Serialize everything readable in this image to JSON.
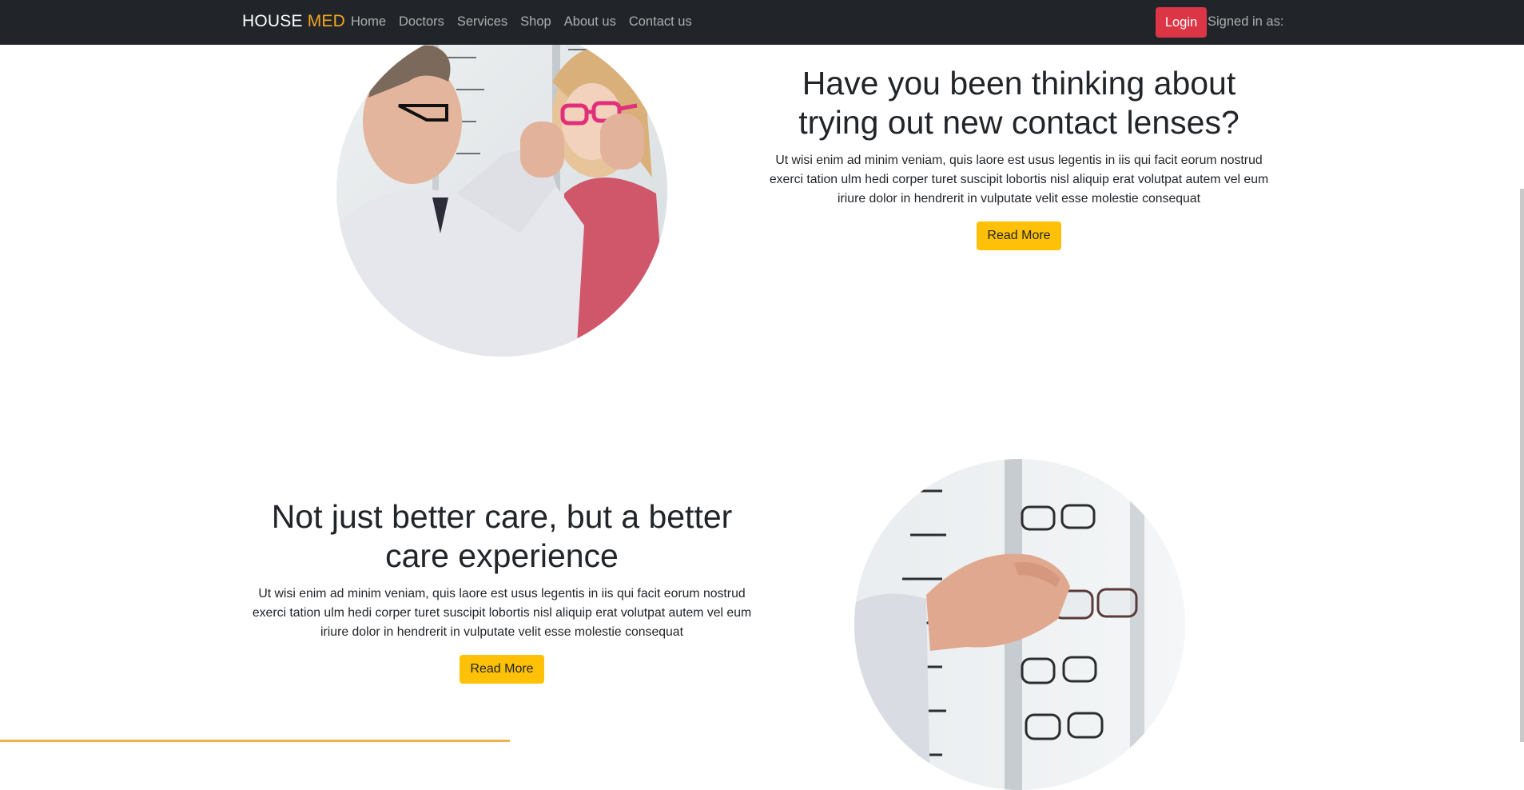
{
  "navbar": {
    "brand_part1": "HOUSE",
    "brand_part2": "MED",
    "links": [
      "Home",
      "Doctors",
      "Services",
      "Shop",
      "About us",
      "Contact us"
    ],
    "login_label": "Login",
    "signed_in_label": "Signed in as:"
  },
  "features": [
    {
      "title_line1": "Have you been thinking about",
      "title_line2": "trying out new contact lenses?",
      "body": "Ut wisi enim ad minim veniam, quis laore est usus legentis in iis qui facit eorum nostrud exerci tation ulm hedi corper turet suscipit lobortis nisl aliquip erat volutpat autem vel eum iriure dolor in hendrerit in vulputate velit esse molestie consequat",
      "button_label": "Read More"
    },
    {
      "title_line1": "Not just better care, but a better",
      "title_line2": "care experience",
      "body": "Ut wisi enim ad minim veniam, quis laore est usus legentis in iis qui facit eorum nostrud exerci tation ulm hedi corper turet suscipit lobortis nisl aliquip erat volutpat autem vel eum iriure dolor in hendrerit in vulputate velit esse molestie consequat",
      "button_label": "Read More"
    }
  ],
  "colors": {
    "navbar_bg": "#212529",
    "brand_accent": "#f5a623",
    "login_bg": "#dc3545",
    "read_more_bg": "#ffc107"
  }
}
